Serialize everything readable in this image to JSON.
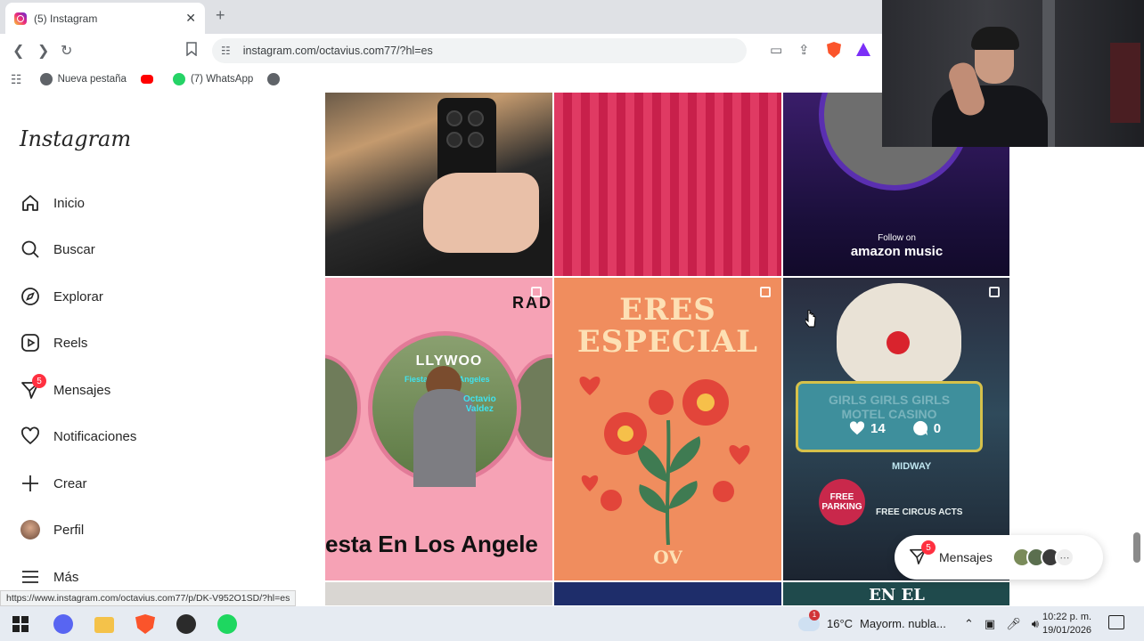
{
  "browser": {
    "tab_title": "(5) Instagram",
    "tab_close": "✕",
    "new_tab": "+",
    "url": "instagram.com/octavius.com77/?hl=es",
    "bookmarks": [
      {
        "label": "Nueva pestaña"
      },
      {
        "label": ""
      },
      {
        "label": "(7) WhatsApp"
      },
      {
        "label": ""
      }
    ],
    "status_link": "https://www.instagram.com/octavius.com77/p/DK-V952O1SD/?hl=es"
  },
  "sidebar": {
    "logo": "Instagram",
    "items": [
      {
        "label": "Inicio",
        "icon": "home-icon"
      },
      {
        "label": "Buscar",
        "icon": "search-icon"
      },
      {
        "label": "Explorar",
        "icon": "compass-icon"
      },
      {
        "label": "Reels",
        "icon": "reels-icon"
      },
      {
        "label": "Mensajes",
        "icon": "messenger-icon",
        "badge": "5"
      },
      {
        "label": "Notificaciones",
        "icon": "heart-icon"
      },
      {
        "label": "Crear",
        "icon": "plus-icon"
      },
      {
        "label": "Perfil",
        "icon": "avatar"
      },
      {
        "label": "Más",
        "icon": "menu-icon"
      }
    ]
  },
  "posts": {
    "amazon_follow": "Follow on",
    "amazon_brand": "amazon music",
    "rad": "RAD",
    "hollywood": "LLYWOO",
    "fiesta_sign": "Fiesta En Los Angeles",
    "octavio": "Octavio\nValdez",
    "fiesta_caption": "esta En Los Angele",
    "eres_line1": "ERES",
    "eres_line2": "ESPECIAL",
    "ov": "OV",
    "casino": "GIRLS GIRLS GIRLS\nMOTEL CASINO",
    "likes": "14",
    "comments": "0",
    "midway": "MIDWAY",
    "free_parking": "FREE PARKING",
    "circus": "FREE CIRCUS ACTS",
    "en_el": "EN EL"
  },
  "messages_pill": {
    "label": "Mensajes",
    "badge": "5"
  },
  "taskbar": {
    "weather_temp": "16°C",
    "weather_desc": "Mayorm. nubla...",
    "weather_badge": "1",
    "time": "10:22 p. m.",
    "date": "19/01/2026"
  },
  "colors": {
    "accent_red": "#ff3040",
    "brave": "#fb542b"
  }
}
